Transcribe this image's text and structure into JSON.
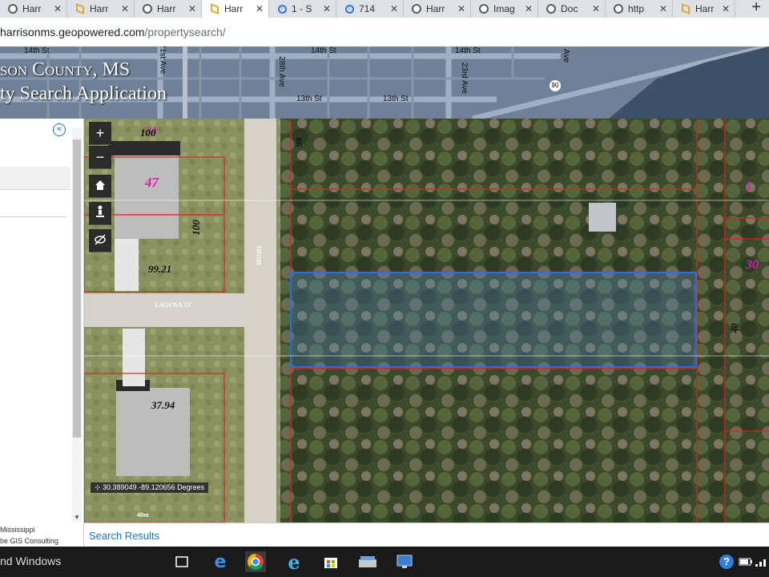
{
  "browser": {
    "tabs": [
      {
        "label": "Harr",
        "icon": "google-icon"
      },
      {
        "label": "Harr",
        "icon": "geopowered-icon"
      },
      {
        "label": "Harr",
        "icon": "google-icon"
      },
      {
        "label": "Harr",
        "icon": "geopowered-icon",
        "active": true
      },
      {
        "label": "1 - S",
        "icon": "arrow-circle-icon"
      },
      {
        "label": "714",
        "icon": "arrow-circle-icon"
      },
      {
        "label": "Harr",
        "icon": "google-icon"
      },
      {
        "label": "Imag",
        "icon": "google-icon"
      },
      {
        "label": "Doc",
        "icon": "google-icon"
      },
      {
        "label": "http",
        "icon": "google-icon"
      },
      {
        "label": "Harr",
        "icon": "geopowered-icon"
      }
    ],
    "new_tab": "+",
    "url_host": "harrisonms.geopowered.com",
    "url_path": "/propertysearch/"
  },
  "header": {
    "title_line1": "son County, MS",
    "title_line2": "ty Search Application",
    "street_labels": [
      "14th St",
      "14th St",
      "14th St",
      "13th St",
      "13th St",
      "21st Ave",
      "28th Ave",
      "23rd Ave",
      "Ave",
      "90"
    ]
  },
  "left_panel": {
    "collapse": "«",
    "credit_line1": "Mississippi",
    "credit_line2": "be GIS Consulting"
  },
  "map": {
    "controls": [
      "+",
      "−",
      "home-icon",
      "person-icon",
      "layers-off-icon"
    ],
    "labels": {
      "lot_34": "34",
      "dim_100_a": "100",
      "lot_47": "47",
      "dim_100_b": "100",
      "dim_9921": "99.21",
      "dim_3794": "37.94",
      "street_vert": "SIGSH",
      "street_horiz": "LAGUNA ST",
      "right_1": "1",
      "right_30": "30",
      "right_dim_40": "40",
      "top_99": "66",
      "scale": "40m"
    },
    "coordinates": "30.389049 -89.120656 Degrees"
  },
  "results": {
    "label": "Search Results"
  },
  "taskbar": {
    "activation_text": "nd Windows"
  },
  "colors": {
    "selection": "#2e6fd6",
    "parcel_lines": "#e02020",
    "banner": "#6b7d95",
    "link": "#1e73c8"
  }
}
